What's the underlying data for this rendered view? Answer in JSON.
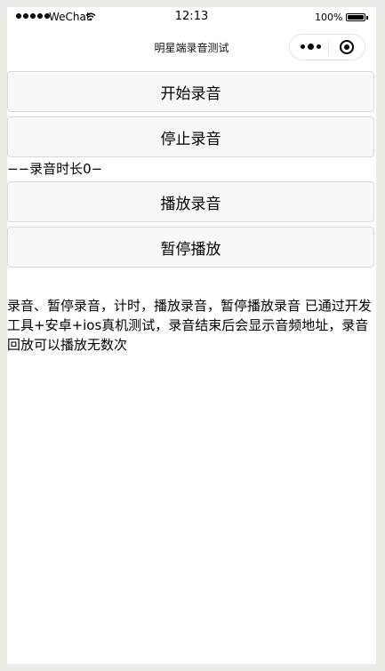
{
  "status_bar": {
    "carrier": "WeChat",
    "time": "12:13",
    "battery": "100%"
  },
  "nav": {
    "title": "明星端录音测试"
  },
  "buttons": {
    "start": "开始录音",
    "stop": "停止录音",
    "play": "播放录音",
    "pause": "暂停播放"
  },
  "duration_text": "−−录音时长0−",
  "description": "录音、暂停录音，计时，播放录音，暂停播放录音 已通过开发工具+安卓+ios真机测试，录音结束后会显示音频地址，录音回放可以播放无数次"
}
